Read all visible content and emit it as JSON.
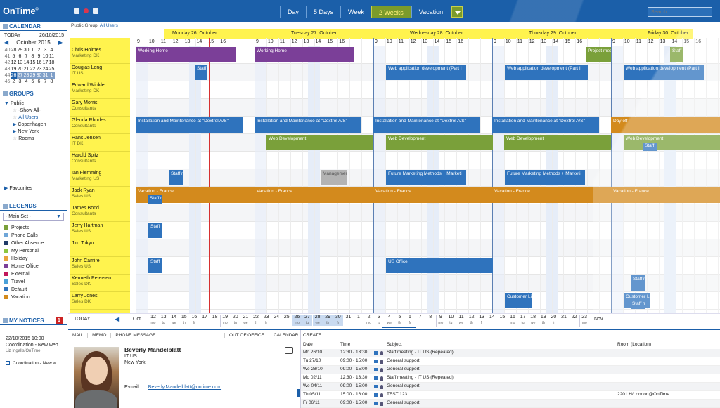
{
  "app": {
    "logo": "OnTime",
    "logo_mark": "®"
  },
  "topbar": {
    "views": [
      "Day",
      "5 Days",
      "Week",
      "2 Weeks",
      "Vacation"
    ],
    "active_view": "2 Weeks",
    "search_placeholder": "Search"
  },
  "sidebar": {
    "calendar_title": "CALENDAR",
    "today_label": "TODAY",
    "today_date": "26/10/2015",
    "month": "October 2015",
    "weeks": [
      {
        "wk": "40",
        "days": [
          "28",
          "29",
          "30",
          "1",
          "2",
          "3",
          "4"
        ]
      },
      {
        "wk": "41",
        "days": [
          "5",
          "6",
          "7",
          "8",
          "9",
          "10",
          "11"
        ]
      },
      {
        "wk": "42",
        "days": [
          "12",
          "13",
          "14",
          "15",
          "16",
          "17",
          "18"
        ]
      },
      {
        "wk": "43",
        "days": [
          "19",
          "20",
          "21",
          "22",
          "23",
          "24",
          "25"
        ]
      },
      {
        "wk": "44",
        "days": [
          "26",
          "27",
          "28",
          "29",
          "30",
          "31",
          "1"
        ]
      },
      {
        "wk": "45",
        "days": [
          "2",
          "3",
          "4",
          "5",
          "6",
          "7",
          "8"
        ]
      }
    ],
    "groups_title": "GROUPS",
    "groups": {
      "public": "Public",
      "show_all": "-Show All-",
      "all_users": "All Users",
      "copenhagen": "Copenhagen",
      "new_york": "New York",
      "rooms": "Rooms"
    },
    "favourites": "Favourites",
    "legends_title": "LEGENDS",
    "legend_set": "- Main Set -",
    "legends": [
      {
        "label": "Projects",
        "color": "#7aa03a"
      },
      {
        "label": "Phone Calls",
        "color": "#6fa6d8"
      },
      {
        "label": "Other Absence",
        "color": "#1f3a68"
      },
      {
        "label": "My Personal",
        "color": "#8dc63f"
      },
      {
        "label": "Holiday",
        "color": "#e8a23c"
      },
      {
        "label": "Home Office",
        "color": "#7b3f98"
      },
      {
        "label": "External",
        "color": "#c2185b"
      },
      {
        "label": "Travel",
        "color": "#4aa0d8"
      },
      {
        "label": "Default",
        "color": "#2f73bd"
      },
      {
        "label": "Vacation",
        "color": "#d38a1d"
      }
    ],
    "notices_title": "MY NOTICES",
    "notices_count": "1",
    "notice_date": "22/10/2015  10:00",
    "notice_text": "Coordination - New web",
    "notice_from": "Liz Ingalls/OnTime",
    "notice_item": "Coordination - New w"
  },
  "main": {
    "public_group_label": "Public Group:",
    "public_group_value": "All Users",
    "days": [
      "Monday 26. October",
      "Tuesday 27. October",
      "Wednesday 28. October",
      "Thursday 29. October",
      "Friday 30. October"
    ],
    "hours": [
      "9",
      "10",
      "11",
      "12",
      "13",
      "14",
      "15",
      "16"
    ],
    "people": [
      {
        "name": "Chris Holmes",
        "dept": "Marketing DK"
      },
      {
        "name": "Douglas Long",
        "dept": "IT US"
      },
      {
        "name": "Edward Winkle",
        "dept": "Marketing DK"
      },
      {
        "name": "Gary Morris",
        "dept": "Consultants"
      },
      {
        "name": "Glenda Rhodes",
        "dept": "Consultants"
      },
      {
        "name": "Hans Jensen",
        "dept": "IT DK"
      },
      {
        "name": "Harold Spitz",
        "dept": "Consultants"
      },
      {
        "name": "Ian Flemming",
        "dept": "Marketing US"
      },
      {
        "name": "Jack Ryan",
        "dept": "Sales US"
      },
      {
        "name": "James Bond",
        "dept": "Consultants"
      },
      {
        "name": "Jerry Hartman",
        "dept": "Sales US"
      },
      {
        "name": "Jiro Tokyo",
        "dept": ""
      },
      {
        "name": "John Camire",
        "dept": "Sales US"
      },
      {
        "name": "Kenneth Petersen",
        "dept": "Sales DK"
      },
      {
        "name": "Larry Jones",
        "dept": "Sales DK"
      }
    ],
    "events": {
      "working_home": "Working Home",
      "project_mee": "Project mee",
      "staff": "Staff",
      "staff_m": "Staff m",
      "web_app": "Web application development (Part I",
      "install": "Installation and Maintenance at \"Dextrol A/S\"",
      "day_off": "Day off",
      "web_dev": "Web Development",
      "management": "Managemen",
      "future_mkt": "Future Marketing Methods + Marketi",
      "vacation": "Vacation - France",
      "us_office": "US Office",
      "customer_li": "Customer Li"
    }
  },
  "timeline": {
    "today": "TODAY",
    "month_oct": "Oct",
    "month_nov": "Nov",
    "days": [
      {
        "d": "12",
        "w": "mo"
      },
      {
        "d": "13",
        "w": "tu"
      },
      {
        "d": "14",
        "w": "we"
      },
      {
        "d": "15",
        "w": "th"
      },
      {
        "d": "16",
        "w": "fr"
      },
      {
        "d": "17",
        "w": ""
      },
      {
        "d": "18",
        "w": ""
      },
      {
        "d": "19",
        "w": "mo"
      },
      {
        "d": "20",
        "w": "tu"
      },
      {
        "d": "21",
        "w": "we"
      },
      {
        "d": "22",
        "w": "th"
      },
      {
        "d": "23",
        "w": "fr"
      },
      {
        "d": "24",
        "w": ""
      },
      {
        "d": "25",
        "w": ""
      },
      {
        "d": "26",
        "w": "mo"
      },
      {
        "d": "27",
        "w": "tu"
      },
      {
        "d": "28",
        "w": "we"
      },
      {
        "d": "29",
        "w": "th"
      },
      {
        "d": "30",
        "w": "fr"
      },
      {
        "d": "31",
        "w": ""
      },
      {
        "d": "1",
        "w": ""
      },
      {
        "d": "2",
        "w": "mo"
      },
      {
        "d": "3",
        "w": "tu"
      },
      {
        "d": "4",
        "w": "we"
      },
      {
        "d": "5",
        "w": "th"
      },
      {
        "d": "6",
        "w": "fr"
      },
      {
        "d": "7",
        "w": ""
      },
      {
        "d": "8",
        "w": ""
      },
      {
        "d": "9",
        "w": "mo"
      },
      {
        "d": "10",
        "w": "tu"
      },
      {
        "d": "11",
        "w": "we"
      },
      {
        "d": "12",
        "w": "th"
      },
      {
        "d": "13",
        "w": "fr"
      },
      {
        "d": "14",
        "w": ""
      },
      {
        "d": "15",
        "w": ""
      },
      {
        "d": "16",
        "w": "mo"
      },
      {
        "d": "17",
        "w": "tu"
      },
      {
        "d": "18",
        "w": "we"
      },
      {
        "d": "19",
        "w": "th"
      },
      {
        "d": "20",
        "w": "fr"
      },
      {
        "d": "21",
        "w": ""
      },
      {
        "d": "22",
        "w": ""
      },
      {
        "d": "23",
        "w": "mo"
      }
    ]
  },
  "bottom": {
    "tabs": [
      "MAIL",
      "MEMO",
      "PHONE MESSAGE"
    ],
    "tabs_right": [
      "OUT OF OFFICE",
      "CALENDAR"
    ],
    "person_name": "Beverly Mandelblatt",
    "person_dept": "IT US",
    "person_city": "New York",
    "email_label": "E-mail:",
    "email": "Beverly.Mandelblatt@ontime.com",
    "create": "CREATE",
    "columns": [
      "Date",
      "Time",
      "Subject",
      "Room (Location)"
    ],
    "rows": [
      {
        "date": "Mo 26/10",
        "time": "12:30 - 13:30",
        "subject": "Staff meeting - IT US (Repeated)",
        "room": ""
      },
      {
        "date": "Tu 27/10",
        "time": "09:00 - 15:00",
        "subject": "General support",
        "room": ""
      },
      {
        "date": "We 28/10",
        "time": "09:00 - 15:00",
        "subject": "General support",
        "room": ""
      },
      {
        "date": "Mo 02/11",
        "time": "12:30 - 13:30",
        "subject": "Staff meeting - IT US (Repeated)",
        "room": ""
      },
      {
        "date": "We 04/11",
        "time": "09:00 - 15:00",
        "subject": "General support",
        "room": ""
      },
      {
        "date": "Th 05/11",
        "time": "15:00 - 16:00",
        "subject": "TEST 123",
        "room": "2201 H/London@OnTime"
      },
      {
        "date": "Fr 06/11",
        "time": "09:00 - 15:00",
        "subject": "General support",
        "room": ""
      }
    ]
  }
}
